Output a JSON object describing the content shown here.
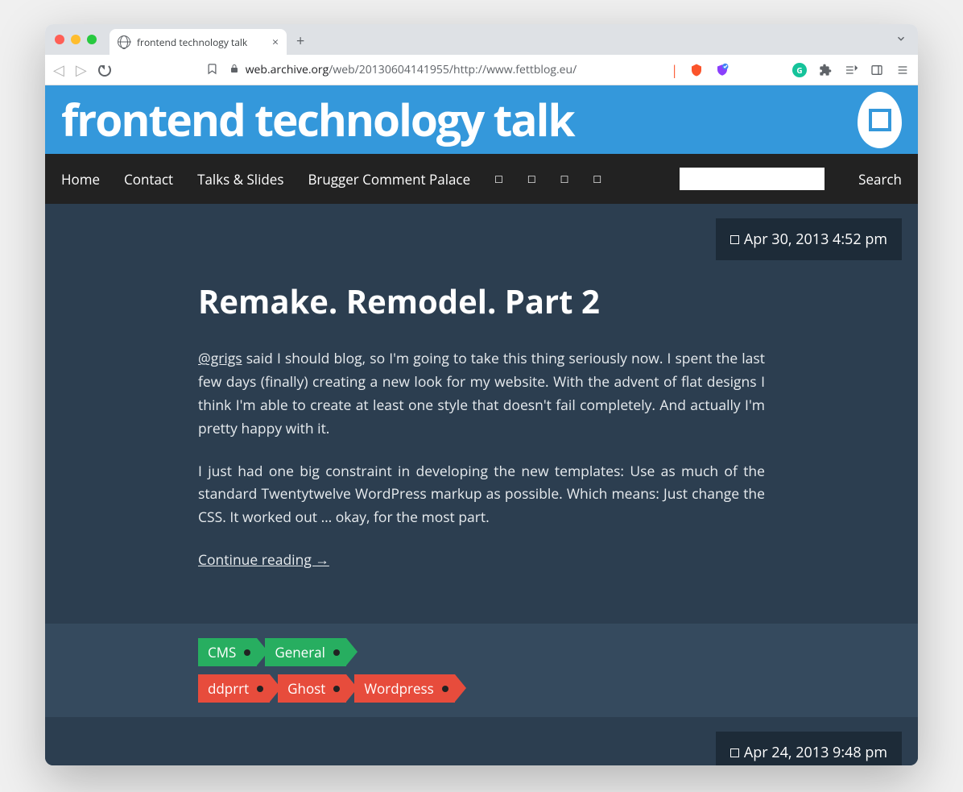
{
  "browser": {
    "tab_title": "frontend technology talk",
    "url_prefix": "web.archive.org",
    "url_rest": "/web/20130604141955/http://www.fettblog.eu/"
  },
  "site": {
    "title": "frontend technology talk"
  },
  "nav": {
    "items": [
      "Home",
      "Contact",
      "Talks & Slides",
      "Brugger Comment Palace"
    ],
    "search_label": "Search"
  },
  "post": {
    "date": "Apr 30, 2013 4:52 pm",
    "title": "Remake. Remodel. Part 2",
    "mention": "@grigs",
    "para1_rest": " said I should blog, so I'm going to take this thing seriously now. I spent the last few days (finally) creating a new look for my website. With the advent of flat designs I think I'm able to create at least one style that doesn't fail completely. And actually I'm pretty happy with it.",
    "para2": "I just had one big constraint in developing the new templates: Use as much of the standard Twentytwelve WordPress markup as possible. Which means: Just change the CSS. It worked out … okay, for the most part.",
    "continue": "Continue reading →",
    "categories": [
      "CMS",
      "General"
    ],
    "tags": [
      "ddprrt",
      "Ghost",
      "Wordpress"
    ]
  },
  "next_post": {
    "date": "Apr 24, 2013 9:48 pm"
  }
}
